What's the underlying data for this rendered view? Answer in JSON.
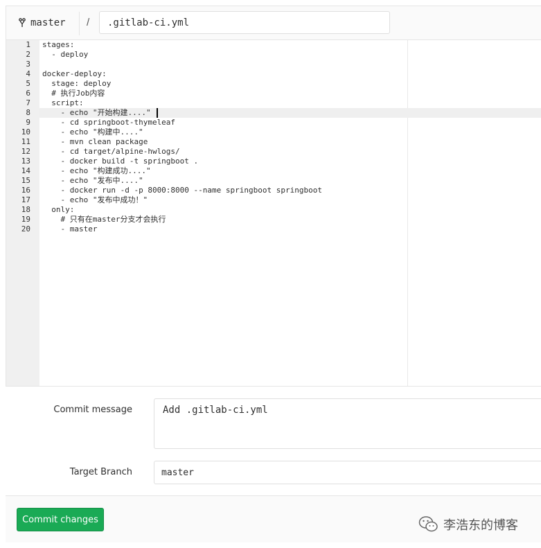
{
  "file_header": {
    "branch_name": "master",
    "path_separator": "/",
    "file_name": ".gitlab-ci.yml"
  },
  "editor": {
    "line_numbers": [
      "1",
      "2",
      "3",
      "4",
      "5",
      "6",
      "7",
      "8",
      "9",
      "10",
      "11",
      "12",
      "13",
      "14",
      "15",
      "16",
      "17",
      "18",
      "19",
      "20"
    ],
    "lines": [
      "stages:",
      "  - deploy",
      "",
      "docker-deploy:",
      "  stage: deploy",
      "  # 执行Job内容",
      "  script:",
      "    - echo \"开始构建....\"",
      "    - cd springboot-thymeleaf",
      "    - echo \"构建中....\"",
      "    - mvn clean package",
      "    - cd target/alpine-hwlogs/",
      "    - docker build -t springboot .",
      "    - echo \"构建成功....\"",
      "    - echo \"发布中....\"",
      "    - docker run -d -p 8000:8000 --name springboot springboot",
      "    - echo \"发布中成功！\"",
      "  only:",
      "    # 只有在master分支才会执行",
      "    - master"
    ],
    "active_line": 8
  },
  "commit_form": {
    "message_label": "Commit message",
    "message_value": "Add .gitlab-ci.yml",
    "branch_label": "Target Branch",
    "branch_value": "master",
    "submit_label": "Commit changes"
  },
  "watermark": {
    "text": "李浩东的博客"
  },
  "colors": {
    "commit_button": "#1aaa55",
    "gutter": "#f0f0f0",
    "active_line": "#efefef"
  },
  "icons": {
    "branch": "git-branch-icon",
    "watermark": "wechat-icon"
  }
}
